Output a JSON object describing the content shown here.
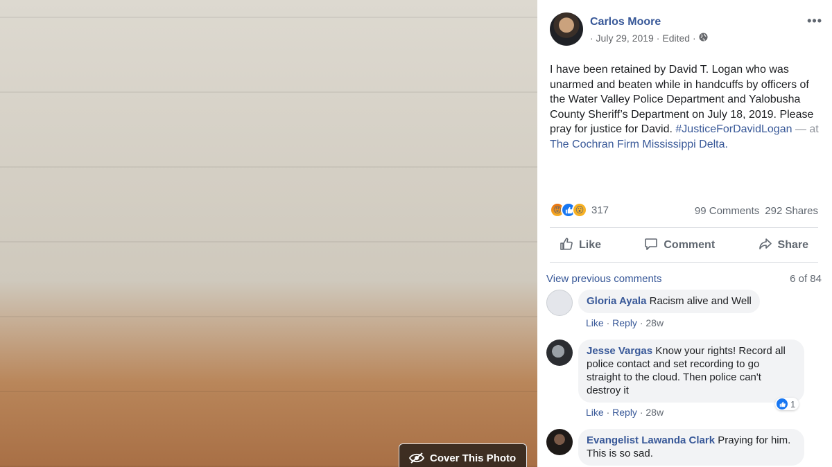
{
  "photo": {
    "placeholder_label": "",
    "cover_button_label": "Cover This Photo"
  },
  "post": {
    "author": "Carlos Moore",
    "date": "· July 29, 2019 ·",
    "edited": "Edited ·",
    "more_label": "•••",
    "text_main": "I have been retained by David T. Logan who was unarmed and beaten while in handcuffs by officers of the Water Valley Police Department and Yalobusha County Sheriff’s Department on July 18, 2019. Please pray for justice for David.",
    "hashtag": "#JusticeForDavidLogan",
    "at_text": " — at ",
    "place": "The Cochran Firm Mississippi Delta.",
    "reactions_count": "317",
    "comments_count": "99 Comments",
    "shares_count": "292 Shares"
  },
  "actions": {
    "like": "Like",
    "comment": "Comment",
    "share": "Share"
  },
  "comments_header": {
    "view_previous": "View previous comments",
    "count": "6 of 84"
  },
  "comments": [
    {
      "name": "Gloria Ayala",
      "text": " Racism alive and Well",
      "like": "Like",
      "reply": "Reply",
      "time": "28w"
    },
    {
      "name": "Jesse Vargas",
      "text": " Know your rights! Record all police contact and set recording to go straight to the cloud. Then police can't destroy it",
      "like": "Like",
      "reply": "Reply",
      "time": "28w",
      "reaction_count": "1"
    },
    {
      "name": "Evangelist Lawanda Clark",
      "text": " Praying for him. This is so sad."
    }
  ],
  "colors": {
    "link": "#385898",
    "muted": "#606770",
    "bubble": "#f2f3f5",
    "reaction_blue": "#1877f2"
  }
}
